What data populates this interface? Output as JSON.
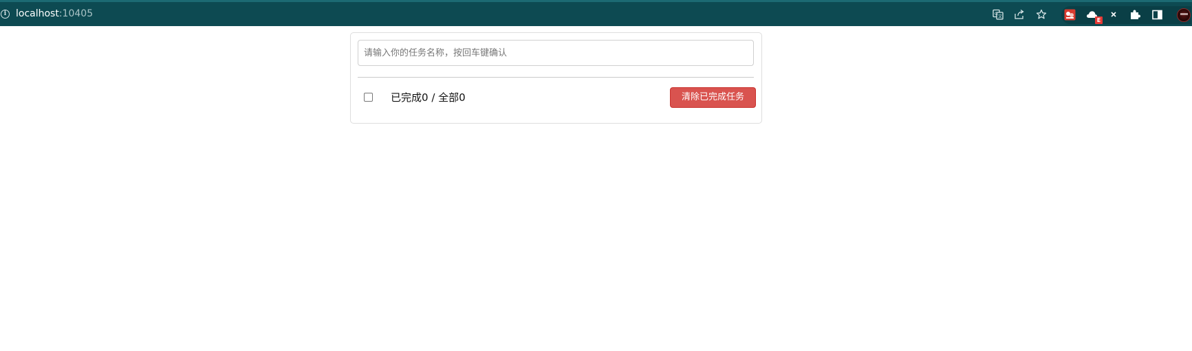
{
  "browser": {
    "url_host": "localhost",
    "url_port": ":10405",
    "badge_text": "E",
    "icons": [
      "info-icon",
      "translate-icon",
      "share-icon",
      "star-icon",
      "extension-red-icon",
      "cloud-icon",
      "x-extension-icon",
      "puzzle-icon",
      "sidebar-icon",
      "avatar"
    ],
    "colors": {
      "bar": "#0d4a52",
      "bar_top": "#1c6a73"
    }
  },
  "todo": {
    "input_placeholder": "请输入你的任务名称，按回车键确认",
    "input_value": "",
    "status": {
      "prefix": "已完成",
      "done": "0",
      "separator": " / ",
      "all_label": "全部",
      "total": "0"
    },
    "clear_button_label": "清除已完成任务",
    "colors": {
      "danger": "#d9534f",
      "border": "#dddddd"
    }
  }
}
